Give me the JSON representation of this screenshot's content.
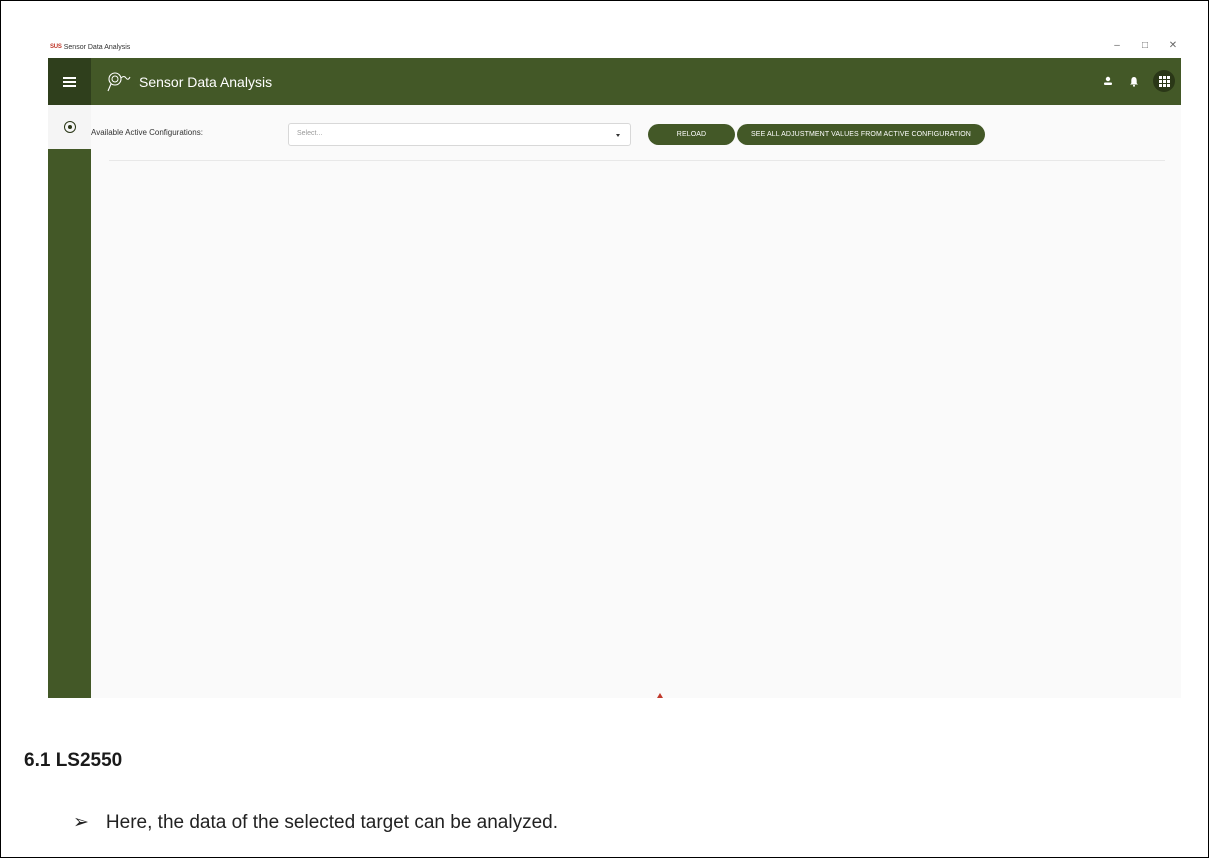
{
  "window": {
    "title": "Sensor Data Analysis",
    "mini_logo": "SUS",
    "controls": {
      "minimize": "–",
      "maximize": "□",
      "close": "✕"
    }
  },
  "appbar": {
    "title": "Sensor Data Analysis",
    "menu_icon": "hamburger-icon",
    "logo_icon": "sensor-logo-icon",
    "right_icons": [
      "user-icon",
      "bell-icon",
      "apps-grid-icon"
    ],
    "color": "#435827",
    "dark_color": "#2f3f1c"
  },
  "sidebar": {
    "items": [
      {
        "icon": "radio-target-icon",
        "active": true
      }
    ]
  },
  "main": {
    "config_label": "Available Active Configurations:",
    "select": {
      "placeholder": "Select...",
      "value": ""
    },
    "reload_button": "RELOAD",
    "see_all_button": "SEE ALL ADJUSTMENT VALUES FROM ACTIVE CONFIGURATION"
  },
  "doc": {
    "section_heading": "6.1 LS2550",
    "bullet_symbol": "➢",
    "bullet_text": "Here, the data of the selected target can be analyzed."
  }
}
